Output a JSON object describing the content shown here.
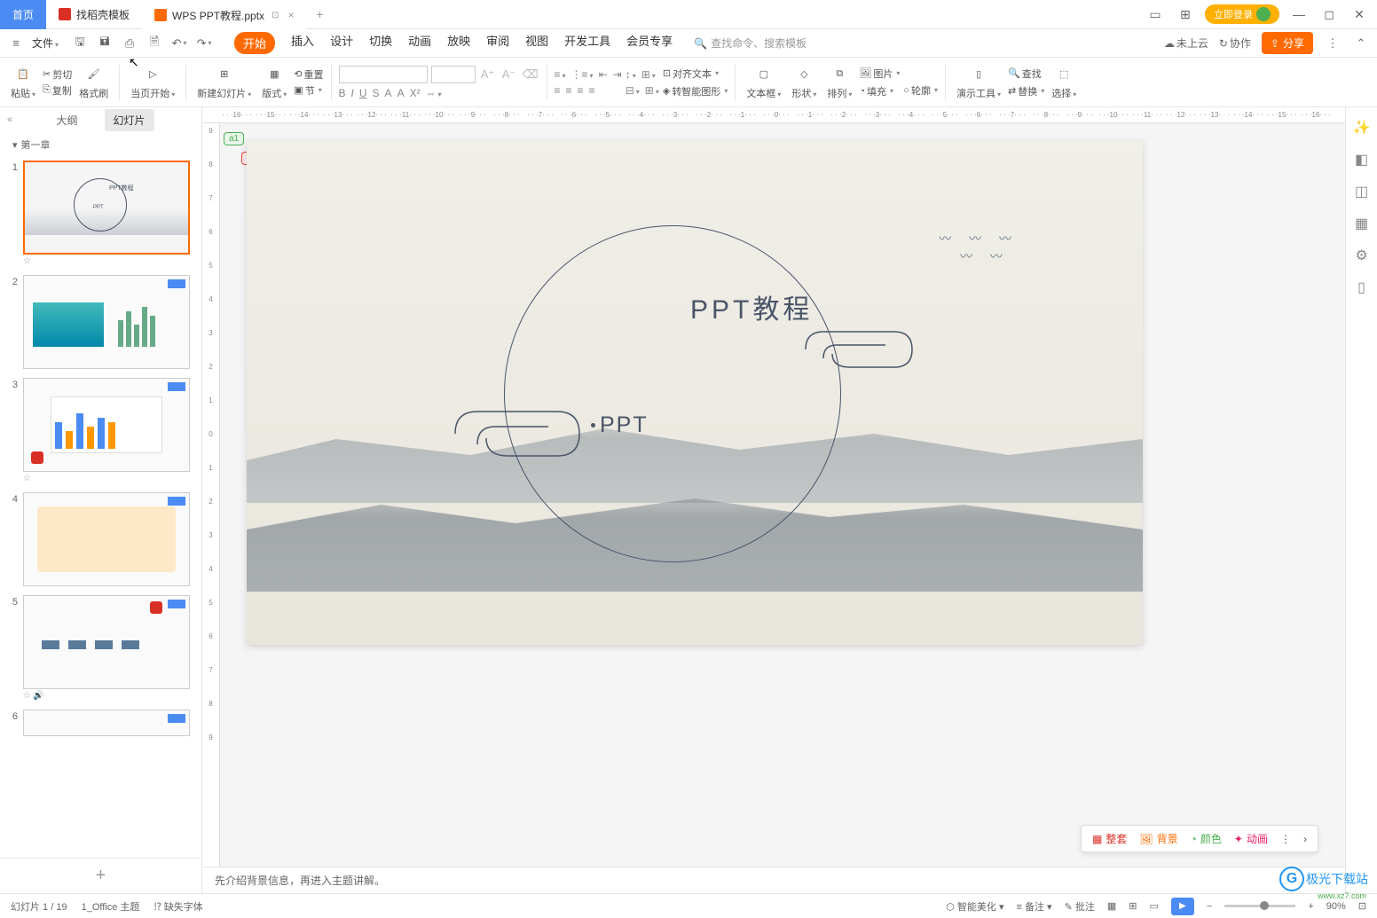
{
  "titlebar": {
    "home": "首页",
    "template": "找稻壳模板",
    "file": "WPS PPT教程.pptx",
    "modified": "⊡",
    "login": "立即登录"
  },
  "menubar": {
    "file": "文件",
    "tabs": [
      "开始",
      "插入",
      "设计",
      "切换",
      "动画",
      "放映",
      "审阅",
      "视图",
      "开发工具",
      "会员专享"
    ],
    "search_placeholder": "查找命令、搜索模板",
    "not_uploaded": "未上云",
    "collab": "协作",
    "share": "分享"
  },
  "ribbon": {
    "paste": "粘贴",
    "cut": "剪切",
    "copy": "复制",
    "format_painter": "格式刷",
    "current_page": "当页开始",
    "new_slide": "新建幻灯片",
    "layout": "版式",
    "reset": "重置",
    "section": "节",
    "align_text": "对齐文本",
    "convert_smart": "转智能图形",
    "text_box": "文本框",
    "shape": "形状",
    "arrange": "排列",
    "picture": "图片",
    "fill": "填充",
    "outline": "轮廓",
    "demo_tools": "演示工具",
    "find": "查找",
    "replace": "替换",
    "select": "选择"
  },
  "slide_panel": {
    "outline": "大纲",
    "slides": "幻灯片",
    "chapter": "第一章"
  },
  "slide": {
    "title_cn": "PPT教程",
    "title_en": "PPT",
    "comment1": "a1",
    "comment2": "a1"
  },
  "ruler_h": [
    "16",
    "15",
    "14",
    "13",
    "12",
    "11",
    "10",
    "9",
    "8",
    "7",
    "6",
    "5",
    "4",
    "3",
    "2",
    "1",
    "0",
    "1",
    "2",
    "3",
    "4",
    "5",
    "6",
    "7",
    "8",
    "9",
    "10",
    "11",
    "12",
    "13",
    "14",
    "15",
    "16"
  ],
  "ruler_v": [
    "9",
    "8",
    "7",
    "6",
    "5",
    "4",
    "3",
    "2",
    "1",
    "0",
    "1",
    "2",
    "3",
    "4",
    "5",
    "6",
    "7",
    "8",
    "9"
  ],
  "float_toolbar": {
    "full_set": "整套",
    "background": "背景",
    "color": "颜色",
    "animation": "动画"
  },
  "notes": "先介绍背景信息，再进入主题讲解。",
  "statusbar": {
    "slide_count": "幻灯片 1 / 19",
    "theme": "1_Office 主题",
    "missing_font": "缺失字体",
    "beautify": "智能美化",
    "notes_btn": "备注",
    "comments_btn": "批注",
    "zoom": "90%"
  },
  "watermark": {
    "text": "极光下载站",
    "url": "www.xz7.com"
  }
}
